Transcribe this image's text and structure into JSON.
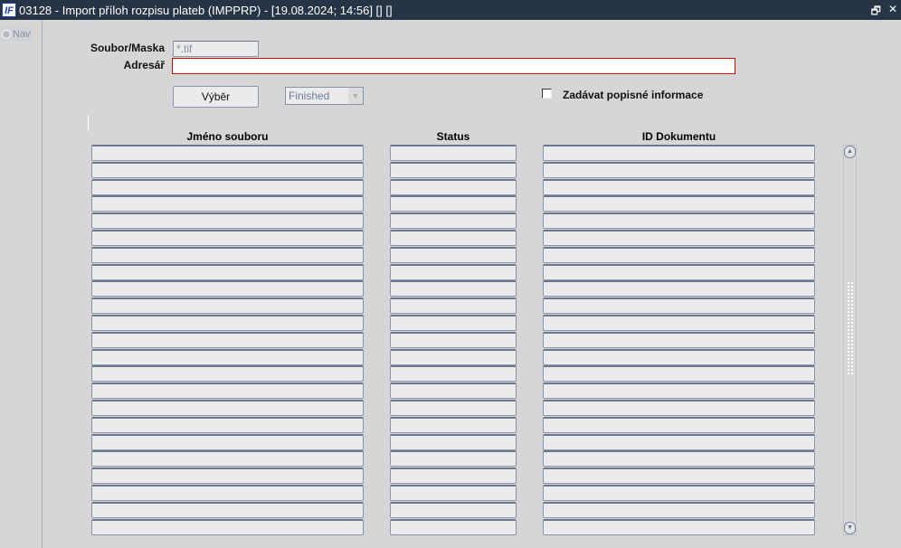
{
  "window": {
    "logo": "IF",
    "title": "03128 - Import příloh rozpisu plateb (IMPPRP) - [19.08.2024; 14:56]  [] []",
    "restore_icon": "restore-icon",
    "close_icon": "close-icon"
  },
  "nav": {
    "label": "Nav"
  },
  "form": {
    "soubor_label": "Soubor/Maska",
    "soubor_value": "*.tif",
    "adresar_label": "Adresář",
    "adresar_value": "",
    "vyber_button": "Výběr",
    "status_select": "Finished",
    "checkbox_label": "Zadávat popisné informace",
    "checkbox_checked": false
  },
  "table": {
    "headers": [
      "Jméno souboru",
      "Status",
      "ID Dokumentu"
    ],
    "row_count": 23
  }
}
